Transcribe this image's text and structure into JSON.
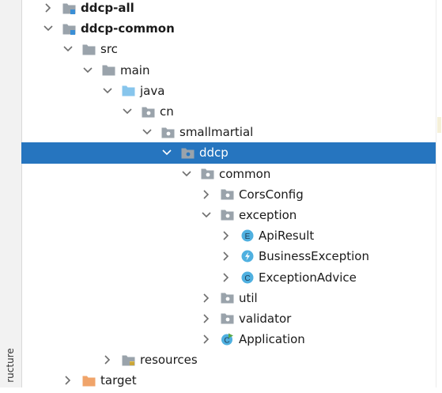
{
  "panel": {
    "side_tab_label": "ructure",
    "selected_index": 7,
    "rows": [
      {
        "label": "ddcp-all",
        "depth": 0,
        "state": "collapsed",
        "icon": "module-folder-icon",
        "bold": true
      },
      {
        "label": "ddcp-common",
        "depth": 0,
        "state": "expanded",
        "icon": "module-folder-icon",
        "bold": true
      },
      {
        "label": "src",
        "depth": 1,
        "state": "expanded",
        "icon": "folder-icon"
      },
      {
        "label": "main",
        "depth": 2,
        "state": "expanded",
        "icon": "folder-icon"
      },
      {
        "label": "java",
        "depth": 3,
        "state": "expanded",
        "icon": "source-folder-icon"
      },
      {
        "label": "cn",
        "depth": 4,
        "state": "expanded",
        "icon": "package-icon"
      },
      {
        "label": "smallmartial",
        "depth": 5,
        "state": "expanded",
        "icon": "package-icon"
      },
      {
        "label": "ddcp",
        "depth": 6,
        "state": "expanded",
        "icon": "package-icon"
      },
      {
        "label": "common",
        "depth": 7,
        "state": "expanded",
        "icon": "package-icon"
      },
      {
        "label": "CorsConfig",
        "depth": 8,
        "state": "collapsed",
        "icon": "package-icon"
      },
      {
        "label": "exception",
        "depth": 8,
        "state": "expanded",
        "icon": "package-icon"
      },
      {
        "label": "ApiResult",
        "depth": 9,
        "state": "collapsed",
        "icon": "enum-icon"
      },
      {
        "label": "BusinessException",
        "depth": 9,
        "state": "collapsed",
        "icon": "exception-class-icon"
      },
      {
        "label": "ExceptionAdvice",
        "depth": 9,
        "state": "collapsed",
        "icon": "class-icon"
      },
      {
        "label": "util",
        "depth": 8,
        "state": "collapsed",
        "icon": "package-icon"
      },
      {
        "label": "validator",
        "depth": 8,
        "state": "collapsed",
        "icon": "package-icon"
      },
      {
        "label": "Application",
        "depth": 8,
        "state": "collapsed",
        "icon": "runnable-class-icon"
      },
      {
        "label": "resources",
        "depth": 3,
        "state": "collapsed",
        "icon": "resources-folder-icon"
      },
      {
        "label": "target",
        "depth": 1,
        "state": "collapsed",
        "icon": "excluded-folder-icon"
      }
    ]
  },
  "colors": {
    "selection": "#2675bf",
    "folder": "#9aa3ab",
    "source_folder": "#87c5ec",
    "module_mark": "#3a8fd6",
    "excluded_folder": "#f0a46a",
    "class_badge": "#4fb0e0",
    "runnable_arrow": "#5aa84a"
  }
}
